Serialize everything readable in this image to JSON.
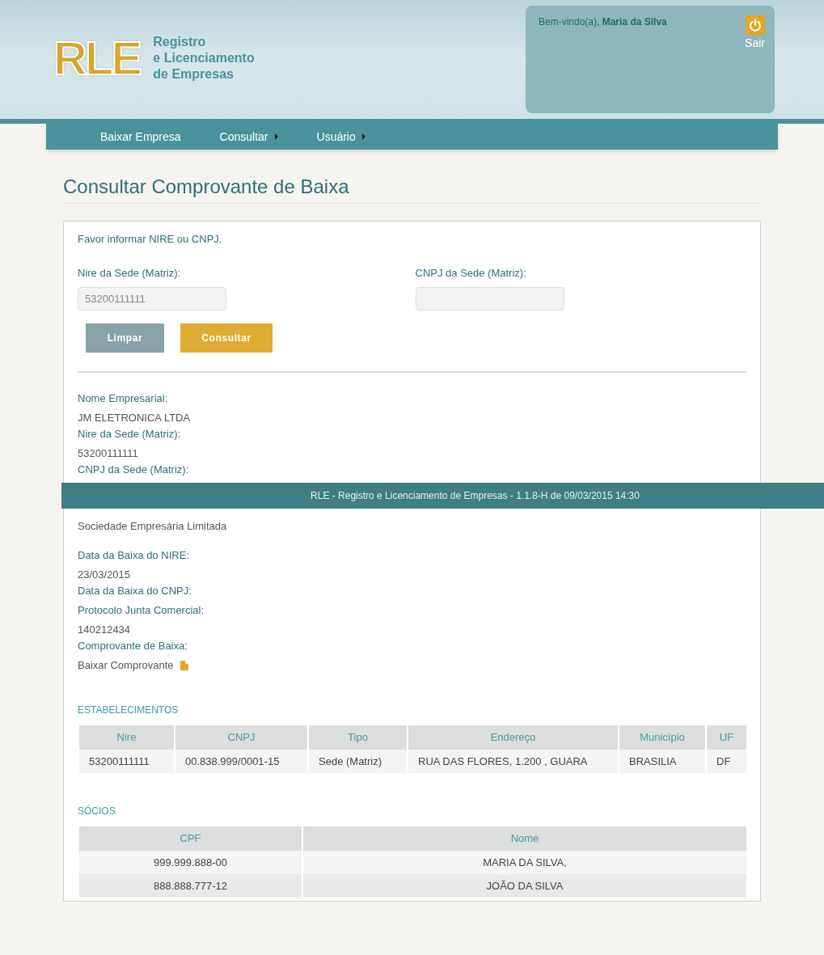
{
  "header": {
    "logo": {
      "mark": "RLE",
      "tagline": [
        "Registro",
        "e Licenciamento",
        "de Empresas"
      ]
    },
    "welcome": {
      "greeting": "Bem-vindo(a),",
      "user": "Maria da Silva"
    },
    "logout": "Sair"
  },
  "nav": [
    {
      "label": "Baixar Empresa",
      "has_submenu": false
    },
    {
      "label": "Consultar",
      "has_submenu": true
    },
    {
      "label": "Usuário",
      "has_submenu": true
    }
  ],
  "title": "Consultar Comprovante de Baixa",
  "form": {
    "hint": "Favor informar NIRE ou CNPJ.",
    "fields": [
      {
        "label": "Nire da Sede (Matriz):",
        "value": "53200111111"
      },
      {
        "label": "CNPJ da Sede (Matriz):"
      }
    ],
    "buttons": [
      {
        "label": "Limpar",
        "kind": "secondary"
      },
      {
        "label": "Consultar",
        "kind": "primary"
      }
    ]
  },
  "details_before_footer": [
    {
      "label": "Nome Empresarial:",
      "value": "JM ELETRONICA LTDA"
    },
    {
      "label": "Nire da Sede (Matriz):",
      "value": "53200111111"
    },
    {
      "label": "CNPJ da Sede (Matriz):"
    }
  ],
  "details_after_footer": [
    {
      "value": "Sociedade Empresária Limitada"
    },
    {
      "label": "Data da Baixa do NIRE:",
      "value": "23/03/2015"
    },
    {
      "label": "Data da Baixa do CNPJ:"
    },
    {
      "label": "Protocolo Junta Comercial:",
      "value": "140212434"
    },
    {
      "label": "Comprovante de Baixa:",
      "value": "Baixar Comprovante",
      "kind": "link"
    }
  ],
  "establishments": {
    "title": "ESTABELECIMENTOS",
    "columns": [
      "Nire",
      "CNPJ",
      "Tipo",
      "Endereço",
      "Município",
      "UF"
    ],
    "rows": [
      [
        "53200111111",
        "00.838.999/0001-15",
        "Sede (Matriz)",
        "RUA DAS FLORES, 1.200 , GUARA",
        "BRASILIA",
        "DF"
      ]
    ]
  },
  "partners": {
    "title": "SÓCIOS",
    "columns": [
      "CPF",
      "Nome"
    ],
    "rows": [
      [
        "999.999.888-00",
        "MARIA DA SILVA,"
      ],
      [
        "888.888.777-12",
        "JOÃO DA SILVA"
      ]
    ]
  },
  "footer": "RLE - Registro e Licenciamento de Empresas - 1.1.8-H de 09/03/2015 14:30"
}
